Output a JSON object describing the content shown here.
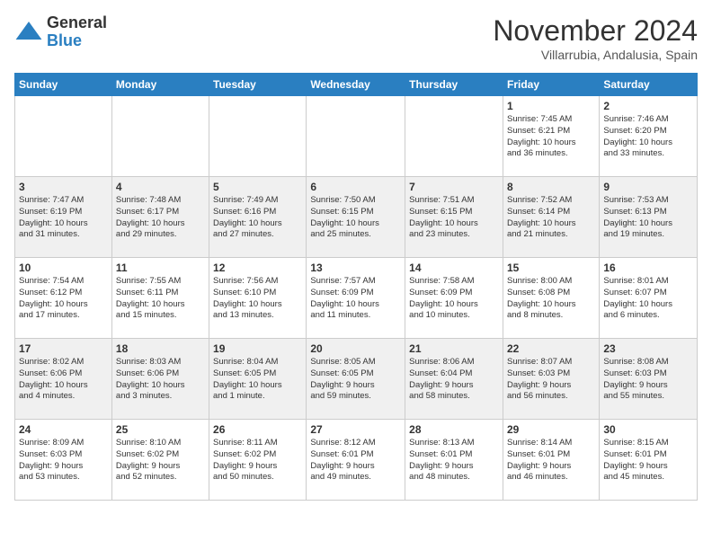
{
  "logo": {
    "general": "General",
    "blue": "Blue"
  },
  "title": "November 2024",
  "subtitle": "Villarrubia, Andalusia, Spain",
  "headers": [
    "Sunday",
    "Monday",
    "Tuesday",
    "Wednesday",
    "Thursday",
    "Friday",
    "Saturday"
  ],
  "weeks": [
    [
      {
        "day": "",
        "info": ""
      },
      {
        "day": "",
        "info": ""
      },
      {
        "day": "",
        "info": ""
      },
      {
        "day": "",
        "info": ""
      },
      {
        "day": "",
        "info": ""
      },
      {
        "day": "1",
        "info": "Sunrise: 7:45 AM\nSunset: 6:21 PM\nDaylight: 10 hours\nand 36 minutes."
      },
      {
        "day": "2",
        "info": "Sunrise: 7:46 AM\nSunset: 6:20 PM\nDaylight: 10 hours\nand 33 minutes."
      }
    ],
    [
      {
        "day": "3",
        "info": "Sunrise: 7:47 AM\nSunset: 6:19 PM\nDaylight: 10 hours\nand 31 minutes."
      },
      {
        "day": "4",
        "info": "Sunrise: 7:48 AM\nSunset: 6:17 PM\nDaylight: 10 hours\nand 29 minutes."
      },
      {
        "day": "5",
        "info": "Sunrise: 7:49 AM\nSunset: 6:16 PM\nDaylight: 10 hours\nand 27 minutes."
      },
      {
        "day": "6",
        "info": "Sunrise: 7:50 AM\nSunset: 6:15 PM\nDaylight: 10 hours\nand 25 minutes."
      },
      {
        "day": "7",
        "info": "Sunrise: 7:51 AM\nSunset: 6:15 PM\nDaylight: 10 hours\nand 23 minutes."
      },
      {
        "day": "8",
        "info": "Sunrise: 7:52 AM\nSunset: 6:14 PM\nDaylight: 10 hours\nand 21 minutes."
      },
      {
        "day": "9",
        "info": "Sunrise: 7:53 AM\nSunset: 6:13 PM\nDaylight: 10 hours\nand 19 minutes."
      }
    ],
    [
      {
        "day": "10",
        "info": "Sunrise: 7:54 AM\nSunset: 6:12 PM\nDaylight: 10 hours\nand 17 minutes."
      },
      {
        "day": "11",
        "info": "Sunrise: 7:55 AM\nSunset: 6:11 PM\nDaylight: 10 hours\nand 15 minutes."
      },
      {
        "day": "12",
        "info": "Sunrise: 7:56 AM\nSunset: 6:10 PM\nDaylight: 10 hours\nand 13 minutes."
      },
      {
        "day": "13",
        "info": "Sunrise: 7:57 AM\nSunset: 6:09 PM\nDaylight: 10 hours\nand 11 minutes."
      },
      {
        "day": "14",
        "info": "Sunrise: 7:58 AM\nSunset: 6:09 PM\nDaylight: 10 hours\nand 10 minutes."
      },
      {
        "day": "15",
        "info": "Sunrise: 8:00 AM\nSunset: 6:08 PM\nDaylight: 10 hours\nand 8 minutes."
      },
      {
        "day": "16",
        "info": "Sunrise: 8:01 AM\nSunset: 6:07 PM\nDaylight: 10 hours\nand 6 minutes."
      }
    ],
    [
      {
        "day": "17",
        "info": "Sunrise: 8:02 AM\nSunset: 6:06 PM\nDaylight: 10 hours\nand 4 minutes."
      },
      {
        "day": "18",
        "info": "Sunrise: 8:03 AM\nSunset: 6:06 PM\nDaylight: 10 hours\nand 3 minutes."
      },
      {
        "day": "19",
        "info": "Sunrise: 8:04 AM\nSunset: 6:05 PM\nDaylight: 10 hours\nand 1 minute."
      },
      {
        "day": "20",
        "info": "Sunrise: 8:05 AM\nSunset: 6:05 PM\nDaylight: 9 hours\nand 59 minutes."
      },
      {
        "day": "21",
        "info": "Sunrise: 8:06 AM\nSunset: 6:04 PM\nDaylight: 9 hours\nand 58 minutes."
      },
      {
        "day": "22",
        "info": "Sunrise: 8:07 AM\nSunset: 6:03 PM\nDaylight: 9 hours\nand 56 minutes."
      },
      {
        "day": "23",
        "info": "Sunrise: 8:08 AM\nSunset: 6:03 PM\nDaylight: 9 hours\nand 55 minutes."
      }
    ],
    [
      {
        "day": "24",
        "info": "Sunrise: 8:09 AM\nSunset: 6:03 PM\nDaylight: 9 hours\nand 53 minutes."
      },
      {
        "day": "25",
        "info": "Sunrise: 8:10 AM\nSunset: 6:02 PM\nDaylight: 9 hours\nand 52 minutes."
      },
      {
        "day": "26",
        "info": "Sunrise: 8:11 AM\nSunset: 6:02 PM\nDaylight: 9 hours\nand 50 minutes."
      },
      {
        "day": "27",
        "info": "Sunrise: 8:12 AM\nSunset: 6:01 PM\nDaylight: 9 hours\nand 49 minutes."
      },
      {
        "day": "28",
        "info": "Sunrise: 8:13 AM\nSunset: 6:01 PM\nDaylight: 9 hours\nand 48 minutes."
      },
      {
        "day": "29",
        "info": "Sunrise: 8:14 AM\nSunset: 6:01 PM\nDaylight: 9 hours\nand 46 minutes."
      },
      {
        "day": "30",
        "info": "Sunrise: 8:15 AM\nSunset: 6:01 PM\nDaylight: 9 hours\nand 45 minutes."
      }
    ]
  ]
}
